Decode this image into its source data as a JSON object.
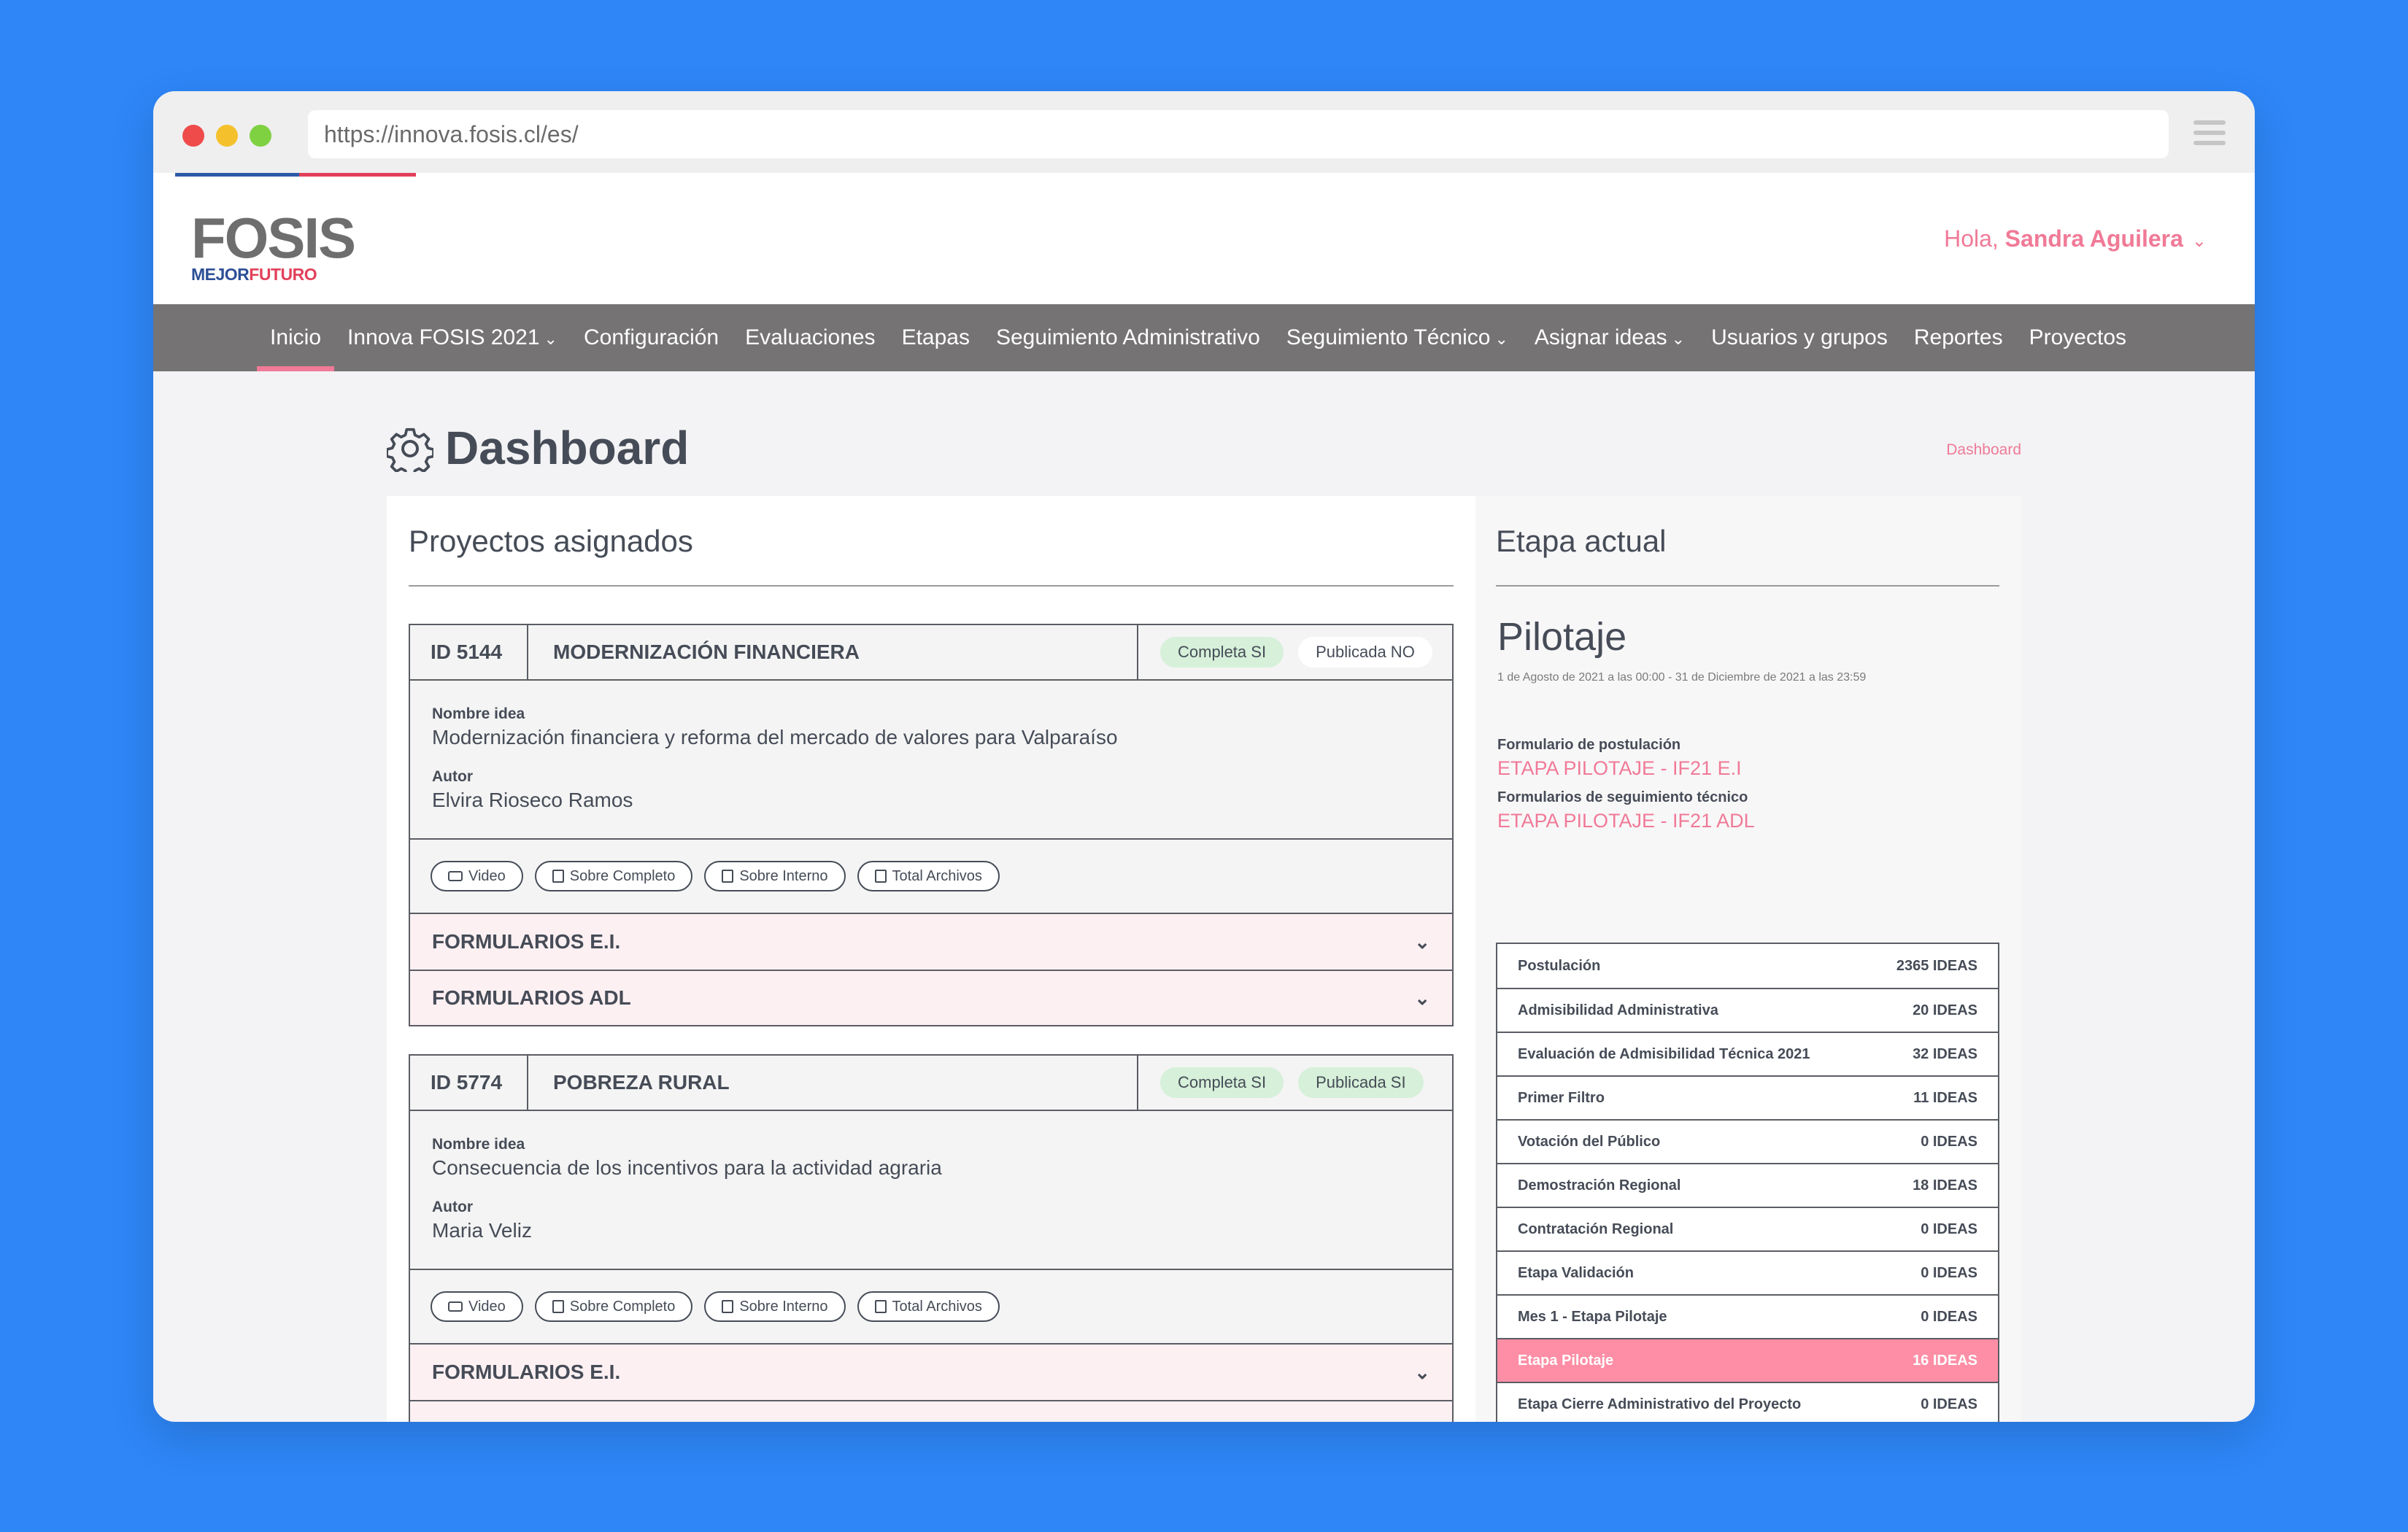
{
  "browser": {
    "url": "https://innova.fosis.cl/es/"
  },
  "header": {
    "logo_main": "FOSIS",
    "logo_sub_a": "MEJOR",
    "logo_sub_b": "FUTURO",
    "greeting": "Hola,",
    "user_name": "Sandra Aguilera"
  },
  "nav": {
    "items": [
      {
        "label": "Inicio"
      },
      {
        "label": "Innova FOSIS 2021"
      },
      {
        "label": "Configuración"
      },
      {
        "label": "Evaluaciones"
      },
      {
        "label": "Etapas"
      },
      {
        "label": "Seguimiento Administrativo"
      },
      {
        "label": "Seguimiento Técnico"
      },
      {
        "label": "Asignar ideas"
      },
      {
        "label": "Usuarios y grupos"
      },
      {
        "label": "Reportes"
      },
      {
        "label": "Proyectos"
      }
    ]
  },
  "page": {
    "title": "Dashboard",
    "breadcrumb": "Dashboard"
  },
  "projects_panel": {
    "title": "Proyectos asignados",
    "projects": [
      {
        "id": "ID 5144",
        "name": "MODERNIZACIÓN FINANCIERA",
        "complete": "Completa SI",
        "published": "Publicada NO",
        "idea_label": "Nombre idea",
        "idea": "Modernización financiera y reforma del mercado de valores para Valparaíso",
        "author_label": "Autor",
        "author": "Elvira Rioseco Ramos",
        "actions": [
          "Video",
          "Sobre Completo",
          "Sobre Interno",
          "Total Archivos"
        ],
        "accordions": [
          "FORMULARIOS E.I.",
          "FORMULARIOS ADL"
        ]
      },
      {
        "id": "ID 5774",
        "name": "POBREZA RURAL",
        "complete": "Completa SI",
        "published": "Publicada SI",
        "idea_label": "Nombre idea",
        "idea": "Consecuencia de los incentivos para la actividad agraria",
        "author_label": "Autor",
        "author": "Maria Veliz",
        "actions": [
          "Video",
          "Sobre Completo",
          "Sobre Interno",
          "Total Archivos"
        ],
        "accordions": [
          "FORMULARIOS E.I."
        ]
      }
    ]
  },
  "stage_panel": {
    "title": "Etapa actual",
    "stage": "Pilotaje",
    "dates": "1 de Agosto de 2021 a las 00:00 - 31 de Diciembre de 2021 a las 23:59",
    "form_label": "Formulario de postulación",
    "form_link": "ETAPA PILOTAJE - IF21 E.I",
    "tracking_label": "Formularios de seguimiento técnico",
    "tracking_link": "ETAPA PILOTAJE - IF21 ADL",
    "stages": [
      {
        "name": "Postulación",
        "count": "2365 IDEAS"
      },
      {
        "name": "Admisibilidad Administrativa",
        "count": "20 IDEAS"
      },
      {
        "name": "Evaluación de Admisibilidad Técnica 2021",
        "count": "32 IDEAS"
      },
      {
        "name": "Primer Filtro",
        "count": "11 IDEAS"
      },
      {
        "name": "Votación del Público",
        "count": "0 IDEAS"
      },
      {
        "name": "Demostración Regional",
        "count": "18 IDEAS"
      },
      {
        "name": "Contratación Regional",
        "count": "0 IDEAS"
      },
      {
        "name": "Etapa Validación",
        "count": "0 IDEAS"
      },
      {
        "name": "Mes 1 - Etapa Pilotaje",
        "count": "0 IDEAS"
      },
      {
        "name": "Etapa Pilotaje",
        "count": "16 IDEAS"
      },
      {
        "name": "Etapa Cierre Administrativo del Proyecto",
        "count": "0 IDEAS"
      }
    ]
  },
  "colors": {
    "background": "#2e86f7",
    "accent": "#f07a97",
    "nav": "#757373",
    "active_row": "#fd8ea5"
  }
}
